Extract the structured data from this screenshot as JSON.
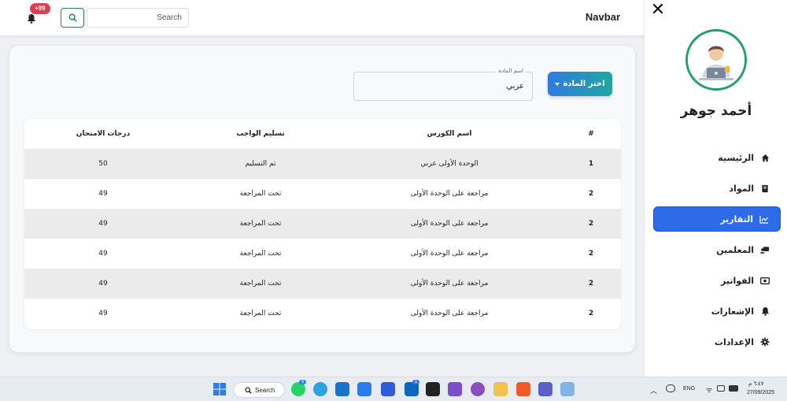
{
  "topbar": {
    "notifications_badge": "+99",
    "search_placeholder": "Search",
    "brand": "Navbar"
  },
  "filter": {
    "select_button_label": "اختر المادة",
    "subject_label": "اسم المادة",
    "subject_value": "عربي"
  },
  "table": {
    "headers": {
      "num": "#",
      "course": "اسم الكورس",
      "homework": "تسليم الواجب",
      "grade": "درجات الامتحان"
    },
    "rows": [
      {
        "num": "1",
        "course": "الوحدة الأولى عربي",
        "homework": "تم التسليم",
        "grade": "50"
      },
      {
        "num": "2",
        "course": "مراجعة على الوحدة الأولى",
        "homework": "تحت المراجعة",
        "grade": "49"
      },
      {
        "num": "2",
        "course": "مراجعة على الوحدة الأولى",
        "homework": "تحت المراجعة",
        "grade": "49"
      },
      {
        "num": "2",
        "course": "مراجعة على الوحدة الأولى",
        "homework": "تحت المراجعة",
        "grade": "49"
      },
      {
        "num": "2",
        "course": "مراجعة على الوحدة الأولى",
        "homework": "تحت المراجعة",
        "grade": "49"
      },
      {
        "num": "2",
        "course": "مراجعة على الوحدة الأولى",
        "homework": "تحت المراجعة",
        "grade": "49"
      }
    ]
  },
  "sidebar": {
    "user_name": "أحمد جوهر",
    "items": [
      {
        "label": "الرئيسية",
        "icon": "home-icon"
      },
      {
        "label": "المواد",
        "icon": "book-icon"
      },
      {
        "label": "التقارير",
        "icon": "chart-icon",
        "active": true
      },
      {
        "label": "المعلمين",
        "icon": "teacher-icon"
      },
      {
        "label": "الفواتير",
        "icon": "money-icon"
      },
      {
        "label": "الإشعارات",
        "icon": "bell-icon"
      },
      {
        "label": "الإعدادات",
        "icon": "gear-icon"
      }
    ]
  },
  "taskbar": {
    "search_label": "Search",
    "language": "ENG",
    "time": "٦:٤٧ م",
    "date": "27/09/2025",
    "whatsapp_badge": "6",
    "linkedin_badge": "1"
  },
  "colors": {
    "accent": "#2d6be8",
    "avatar_ring": "#22a06b",
    "badge": "#e53a4f"
  }
}
